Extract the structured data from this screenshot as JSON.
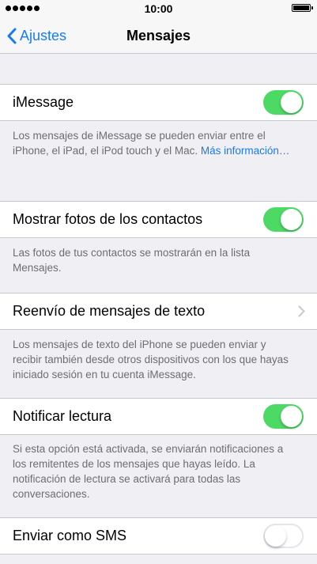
{
  "status_bar": {
    "time": "10:00"
  },
  "nav": {
    "back_label": "Ajustes",
    "title": "Mensajes"
  },
  "colors": {
    "accent": "#1a7bf0",
    "toggle_on": "#4cd964"
  },
  "settings": [
    {
      "label": "iMessage",
      "control": "toggle",
      "state": "on",
      "footer": "Los mensajes de iMessage se pueden enviar entre el iPhone, el iPad, el iPod touch y el Mac. ",
      "footer_link": "Más información…"
    },
    {
      "label": "Mostrar fotos de los contactos",
      "control": "toggle",
      "state": "on",
      "footer": "Las fotos de tus contactos se mostrarán en la lista Mensajes."
    },
    {
      "label": "Reenvío de mensajes de texto",
      "control": "disclosure",
      "footer": "Los mensajes de texto del iPhone se pueden enviar y recibir también desde otros dispositivos con los que hayas iniciado sesión en tu cuenta iMessage."
    },
    {
      "label": "Notificar lectura",
      "control": "toggle",
      "state": "on",
      "footer": "Si esta opción está activada, se enviarán notificaciones a los remitentes de los mensajes que hayas leído. La notificación de lectura se activará para todas las conversaciones."
    },
    {
      "label": "Enviar como SMS",
      "control": "toggle",
      "state": "off"
    }
  ]
}
